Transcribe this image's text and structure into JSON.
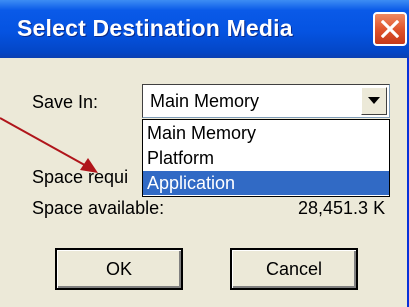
{
  "window": {
    "title": "Select Destination Media",
    "close_icon": "close-icon"
  },
  "form": {
    "save_in_label": "Save In:",
    "save_in_value": "Main Memory",
    "space_required_label": "Space requi",
    "space_available_label": "Space available:",
    "space_available_value": "28,451.3 K"
  },
  "dropdown": {
    "options": [
      "Main Memory",
      "Platform",
      "Application"
    ],
    "highlighted": "Application"
  },
  "buttons": {
    "ok": "OK",
    "cancel": "Cancel"
  },
  "colors": {
    "titlebar": "#0553e1",
    "highlight": "#316ac5",
    "annotation_arrow": "#b0151b",
    "dialog_bg": "#ece9d8"
  }
}
